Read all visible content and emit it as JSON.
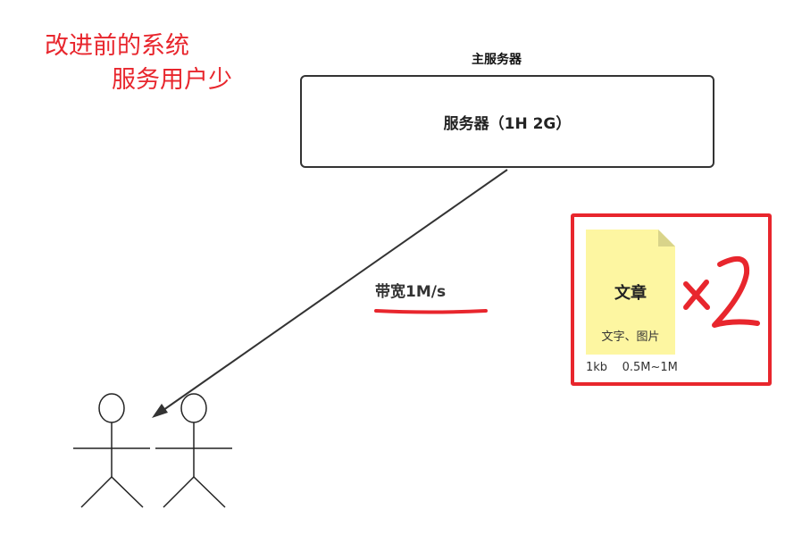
{
  "annotation": {
    "line1": "改进前的系统",
    "line2": "服务用户少",
    "color": "#e8262d"
  },
  "server": {
    "title": "主服务器",
    "label": "服务器（1H  2G）"
  },
  "connection": {
    "bandwidth_label": "带宽1M/s"
  },
  "document": {
    "title": "文章",
    "subtitle": "文字、图片",
    "sizes": "1kb    0.5M~1M",
    "note_color": "#fdf6a1",
    "fold_color": "#d9d48a",
    "multiplier": "x2"
  },
  "users": {
    "count": 2,
    "icon": "stick-figure-icon"
  }
}
